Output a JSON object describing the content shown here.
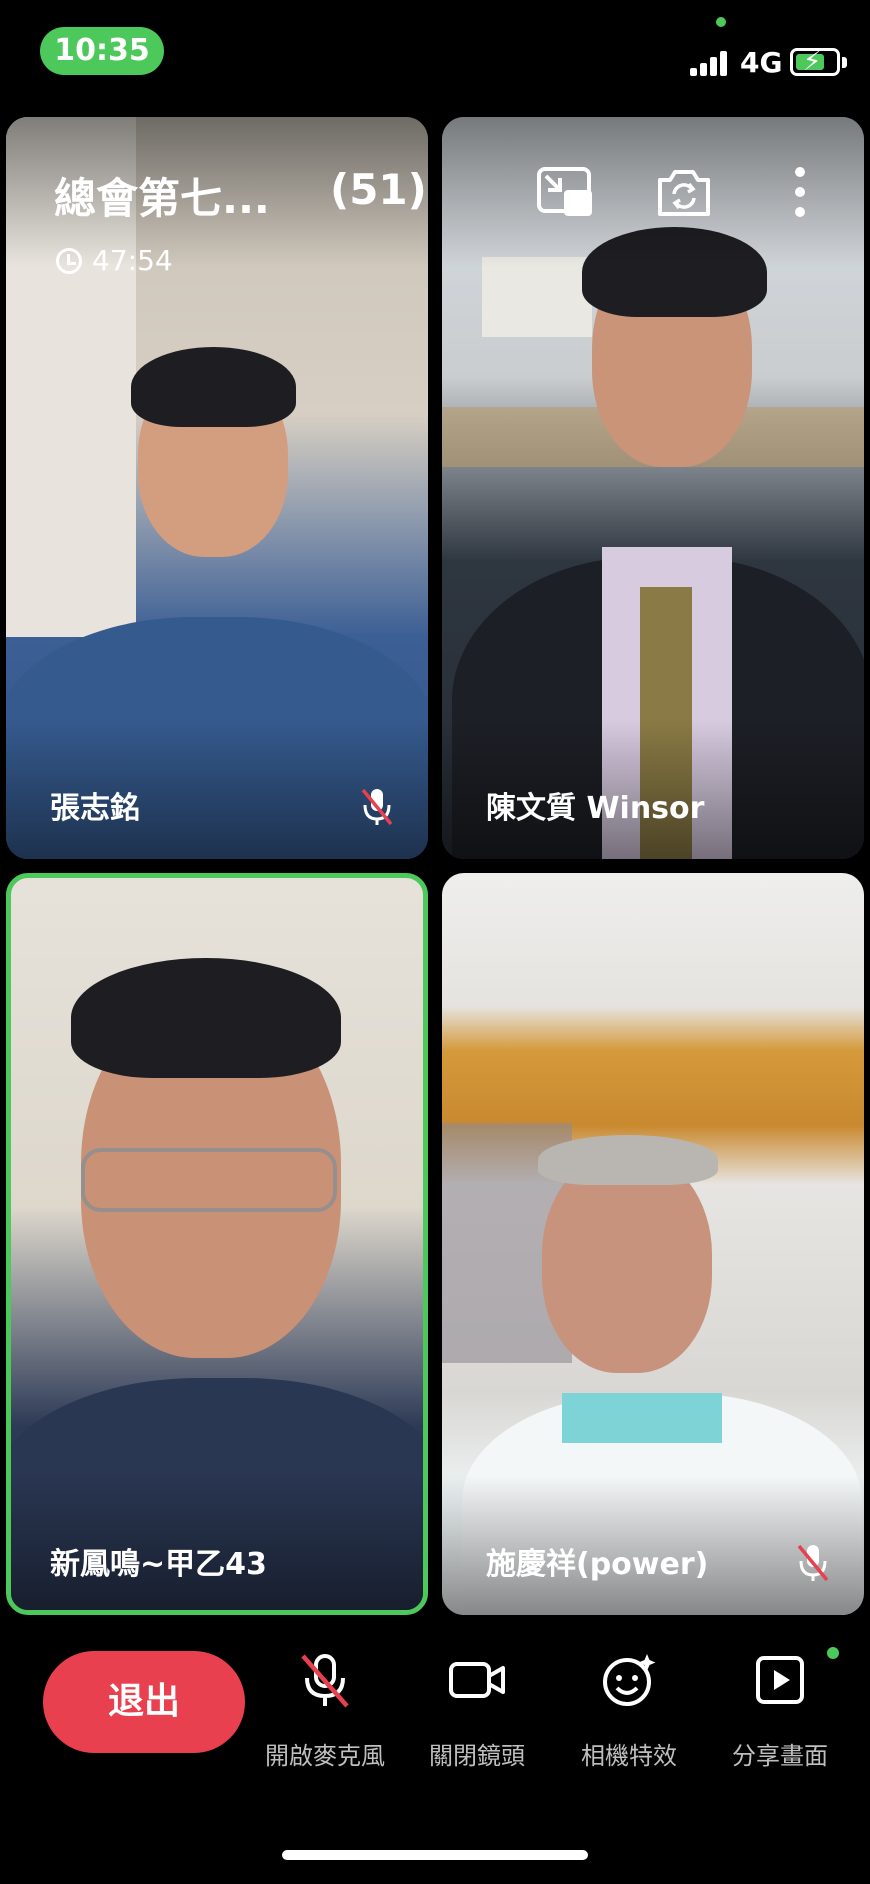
{
  "status_bar": {
    "time": "10:35",
    "network": "4G"
  },
  "meeting": {
    "title": "總會第七...",
    "participant_count": "(51)",
    "elapsed": "47:54"
  },
  "participants": [
    {
      "name": "張志銘",
      "muted": true
    },
    {
      "name": "陳文質 Winsor",
      "muted": false
    },
    {
      "name": "新鳳鳴~甲乙43",
      "muted": false,
      "active_speaker": true
    },
    {
      "name": "施慶祥(power)",
      "muted": true
    }
  ],
  "controls": {
    "exit_label": "退出",
    "mic_label": "開啟麥克風",
    "camera_label": "關閉鏡頭",
    "effects_label": "相機特效",
    "share_label": "分享畫面"
  },
  "icons": [
    "pip-icon",
    "switch-camera-icon",
    "more-icon",
    "mic-off-icon",
    "video-camera-icon",
    "face-effects-icon",
    "share-screen-icon"
  ],
  "colors": {
    "accent_green": "#4cc95a",
    "exit_red": "#e9404f"
  }
}
